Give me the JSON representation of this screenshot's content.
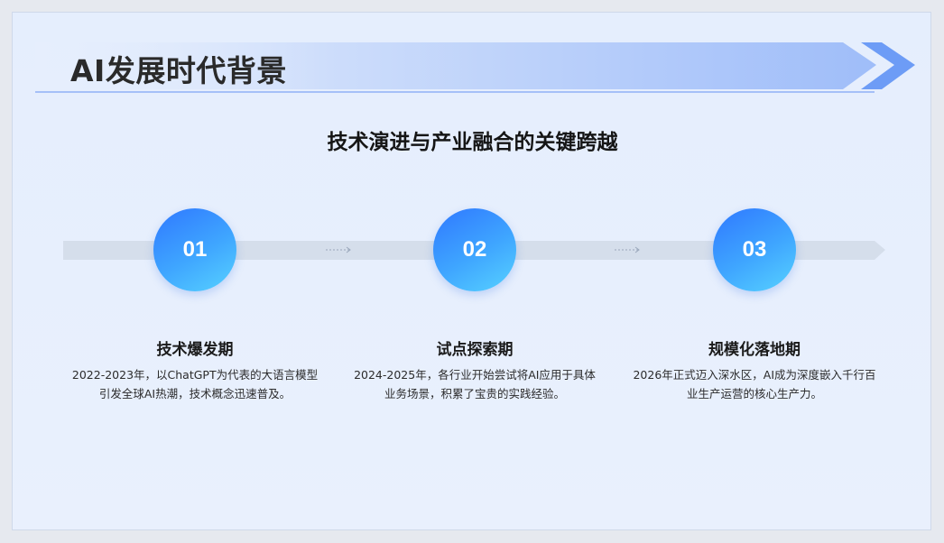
{
  "header": {
    "title": "AI发展时代背景"
  },
  "subtitle": "技术演进与产业融合的关键跨越",
  "steps": [
    {
      "number": "01",
      "title": "技术爆发期",
      "desc_line1": "2022-2023年，以ChatGPT为代表的大语言模型",
      "desc_line2": "引发全球AI热潮，技术概念迅速普及。"
    },
    {
      "number": "02",
      "title": "试点探索期",
      "desc_line1": "2024-2025年，各行业开始尝试将AI应用于具体",
      "desc_line2": "业务场景，积累了宝贵的实践经验。"
    },
    {
      "number": "03",
      "title": "规模化落地期",
      "desc_line1": "2026年正式迈入深水区，AI成为深度嵌入千行百",
      "desc_line2": "业生产运营的核心生产力。"
    }
  ],
  "colors": {
    "accent": "#2f78ff",
    "accent_light": "#57d2ff",
    "background": "#e7effd"
  }
}
